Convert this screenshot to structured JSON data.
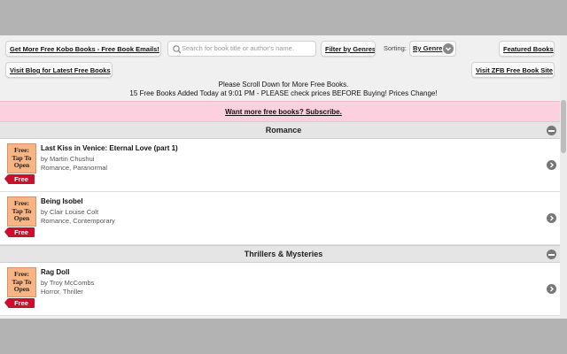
{
  "toolbar": {
    "email_button": "Get More Free Kobo Books - Free Book Emails!",
    "search_placeholder": "Search for book title or author's name.",
    "filter_button": "Filter by Genres",
    "sort_label": "Sorting:",
    "sort_value": "By Genre",
    "featured_button": "Featured Books",
    "blog_button": "Visit Blog for Latest Free Books",
    "site_button": "Visit ZFB Free Book Site"
  },
  "notice": {
    "line1": "Please Scroll Down for More Free Books.",
    "line2": "15 Free Books Added Today at 9:01 PM - PLEASE check prices BEFORE Buying! Prices Change!"
  },
  "subscribe": {
    "label": "Want more free books? Subscribe."
  },
  "sections": [
    {
      "name": "Romance",
      "books": [
        {
          "cover": [
            "Free:",
            "Tap To",
            "Open"
          ],
          "badge": "Free",
          "title": "Last Kiss in Venice: Eternal Love (part 1)",
          "author": "by Martin Chushui",
          "genres": "Romance, Paranormal"
        },
        {
          "cover": [
            "Free:",
            "Tap To",
            "Open"
          ],
          "badge": "Free",
          "title": "Being Isobel",
          "author": "by Clair Louise Colt",
          "genres": "Romance, Contemporary"
        }
      ]
    },
    {
      "name": "Thrillers & Mysteries",
      "books": [
        {
          "cover": [
            "Free:",
            "Tap To",
            "Open"
          ],
          "badge": "Free",
          "title": "Rag Doll",
          "author": "by Troy McCombs",
          "genres": "Horror, Thriller"
        }
      ]
    }
  ],
  "colors": {
    "subscribe_bg": "#fcd0df",
    "cover_bg": "#f8b584",
    "free_tag": "#c8102e",
    "page_bg": "#f0f0f0",
    "frame_bg": "#b3b3b3"
  }
}
